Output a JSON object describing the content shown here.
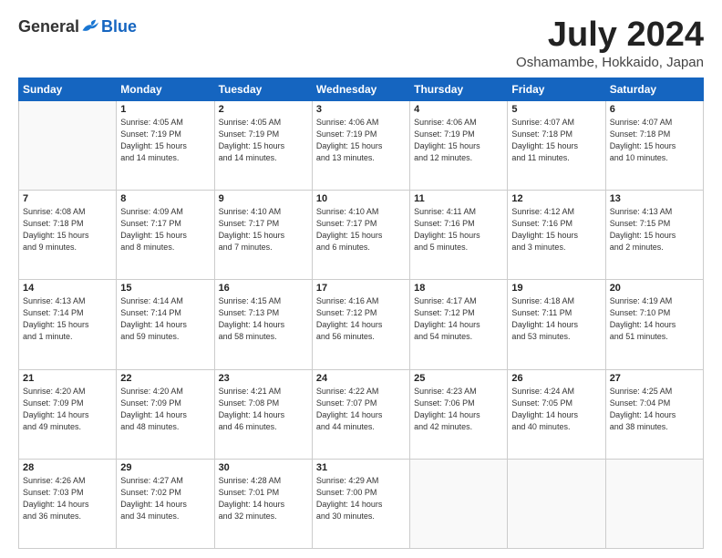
{
  "logo": {
    "general": "General",
    "blue": "Blue"
  },
  "title": "July 2024",
  "location": "Oshamambe, Hokkaido, Japan",
  "headers": [
    "Sunday",
    "Monday",
    "Tuesday",
    "Wednesday",
    "Thursday",
    "Friday",
    "Saturday"
  ],
  "weeks": [
    [
      {
        "day": "",
        "info": ""
      },
      {
        "day": "1",
        "info": "Sunrise: 4:05 AM\nSunset: 7:19 PM\nDaylight: 15 hours\nand 14 minutes."
      },
      {
        "day": "2",
        "info": "Sunrise: 4:05 AM\nSunset: 7:19 PM\nDaylight: 15 hours\nand 14 minutes."
      },
      {
        "day": "3",
        "info": "Sunrise: 4:06 AM\nSunset: 7:19 PM\nDaylight: 15 hours\nand 13 minutes."
      },
      {
        "day": "4",
        "info": "Sunrise: 4:06 AM\nSunset: 7:19 PM\nDaylight: 15 hours\nand 12 minutes."
      },
      {
        "day": "5",
        "info": "Sunrise: 4:07 AM\nSunset: 7:18 PM\nDaylight: 15 hours\nand 11 minutes."
      },
      {
        "day": "6",
        "info": "Sunrise: 4:07 AM\nSunset: 7:18 PM\nDaylight: 15 hours\nand 10 minutes."
      }
    ],
    [
      {
        "day": "7",
        "info": "Sunrise: 4:08 AM\nSunset: 7:18 PM\nDaylight: 15 hours\nand 9 minutes."
      },
      {
        "day": "8",
        "info": "Sunrise: 4:09 AM\nSunset: 7:17 PM\nDaylight: 15 hours\nand 8 minutes."
      },
      {
        "day": "9",
        "info": "Sunrise: 4:10 AM\nSunset: 7:17 PM\nDaylight: 15 hours\nand 7 minutes."
      },
      {
        "day": "10",
        "info": "Sunrise: 4:10 AM\nSunset: 7:17 PM\nDaylight: 15 hours\nand 6 minutes."
      },
      {
        "day": "11",
        "info": "Sunrise: 4:11 AM\nSunset: 7:16 PM\nDaylight: 15 hours\nand 5 minutes."
      },
      {
        "day": "12",
        "info": "Sunrise: 4:12 AM\nSunset: 7:16 PM\nDaylight: 15 hours\nand 3 minutes."
      },
      {
        "day": "13",
        "info": "Sunrise: 4:13 AM\nSunset: 7:15 PM\nDaylight: 15 hours\nand 2 minutes."
      }
    ],
    [
      {
        "day": "14",
        "info": "Sunrise: 4:13 AM\nSunset: 7:14 PM\nDaylight: 15 hours\nand 1 minute."
      },
      {
        "day": "15",
        "info": "Sunrise: 4:14 AM\nSunset: 7:14 PM\nDaylight: 14 hours\nand 59 minutes."
      },
      {
        "day": "16",
        "info": "Sunrise: 4:15 AM\nSunset: 7:13 PM\nDaylight: 14 hours\nand 58 minutes."
      },
      {
        "day": "17",
        "info": "Sunrise: 4:16 AM\nSunset: 7:12 PM\nDaylight: 14 hours\nand 56 minutes."
      },
      {
        "day": "18",
        "info": "Sunrise: 4:17 AM\nSunset: 7:12 PM\nDaylight: 14 hours\nand 54 minutes."
      },
      {
        "day": "19",
        "info": "Sunrise: 4:18 AM\nSunset: 7:11 PM\nDaylight: 14 hours\nand 53 minutes."
      },
      {
        "day": "20",
        "info": "Sunrise: 4:19 AM\nSunset: 7:10 PM\nDaylight: 14 hours\nand 51 minutes."
      }
    ],
    [
      {
        "day": "21",
        "info": "Sunrise: 4:20 AM\nSunset: 7:09 PM\nDaylight: 14 hours\nand 49 minutes."
      },
      {
        "day": "22",
        "info": "Sunrise: 4:20 AM\nSunset: 7:09 PM\nDaylight: 14 hours\nand 48 minutes."
      },
      {
        "day": "23",
        "info": "Sunrise: 4:21 AM\nSunset: 7:08 PM\nDaylight: 14 hours\nand 46 minutes."
      },
      {
        "day": "24",
        "info": "Sunrise: 4:22 AM\nSunset: 7:07 PM\nDaylight: 14 hours\nand 44 minutes."
      },
      {
        "day": "25",
        "info": "Sunrise: 4:23 AM\nSunset: 7:06 PM\nDaylight: 14 hours\nand 42 minutes."
      },
      {
        "day": "26",
        "info": "Sunrise: 4:24 AM\nSunset: 7:05 PM\nDaylight: 14 hours\nand 40 minutes."
      },
      {
        "day": "27",
        "info": "Sunrise: 4:25 AM\nSunset: 7:04 PM\nDaylight: 14 hours\nand 38 minutes."
      }
    ],
    [
      {
        "day": "28",
        "info": "Sunrise: 4:26 AM\nSunset: 7:03 PM\nDaylight: 14 hours\nand 36 minutes."
      },
      {
        "day": "29",
        "info": "Sunrise: 4:27 AM\nSunset: 7:02 PM\nDaylight: 14 hours\nand 34 minutes."
      },
      {
        "day": "30",
        "info": "Sunrise: 4:28 AM\nSunset: 7:01 PM\nDaylight: 14 hours\nand 32 minutes."
      },
      {
        "day": "31",
        "info": "Sunrise: 4:29 AM\nSunset: 7:00 PM\nDaylight: 14 hours\nand 30 minutes."
      },
      {
        "day": "",
        "info": ""
      },
      {
        "day": "",
        "info": ""
      },
      {
        "day": "",
        "info": ""
      }
    ]
  ]
}
